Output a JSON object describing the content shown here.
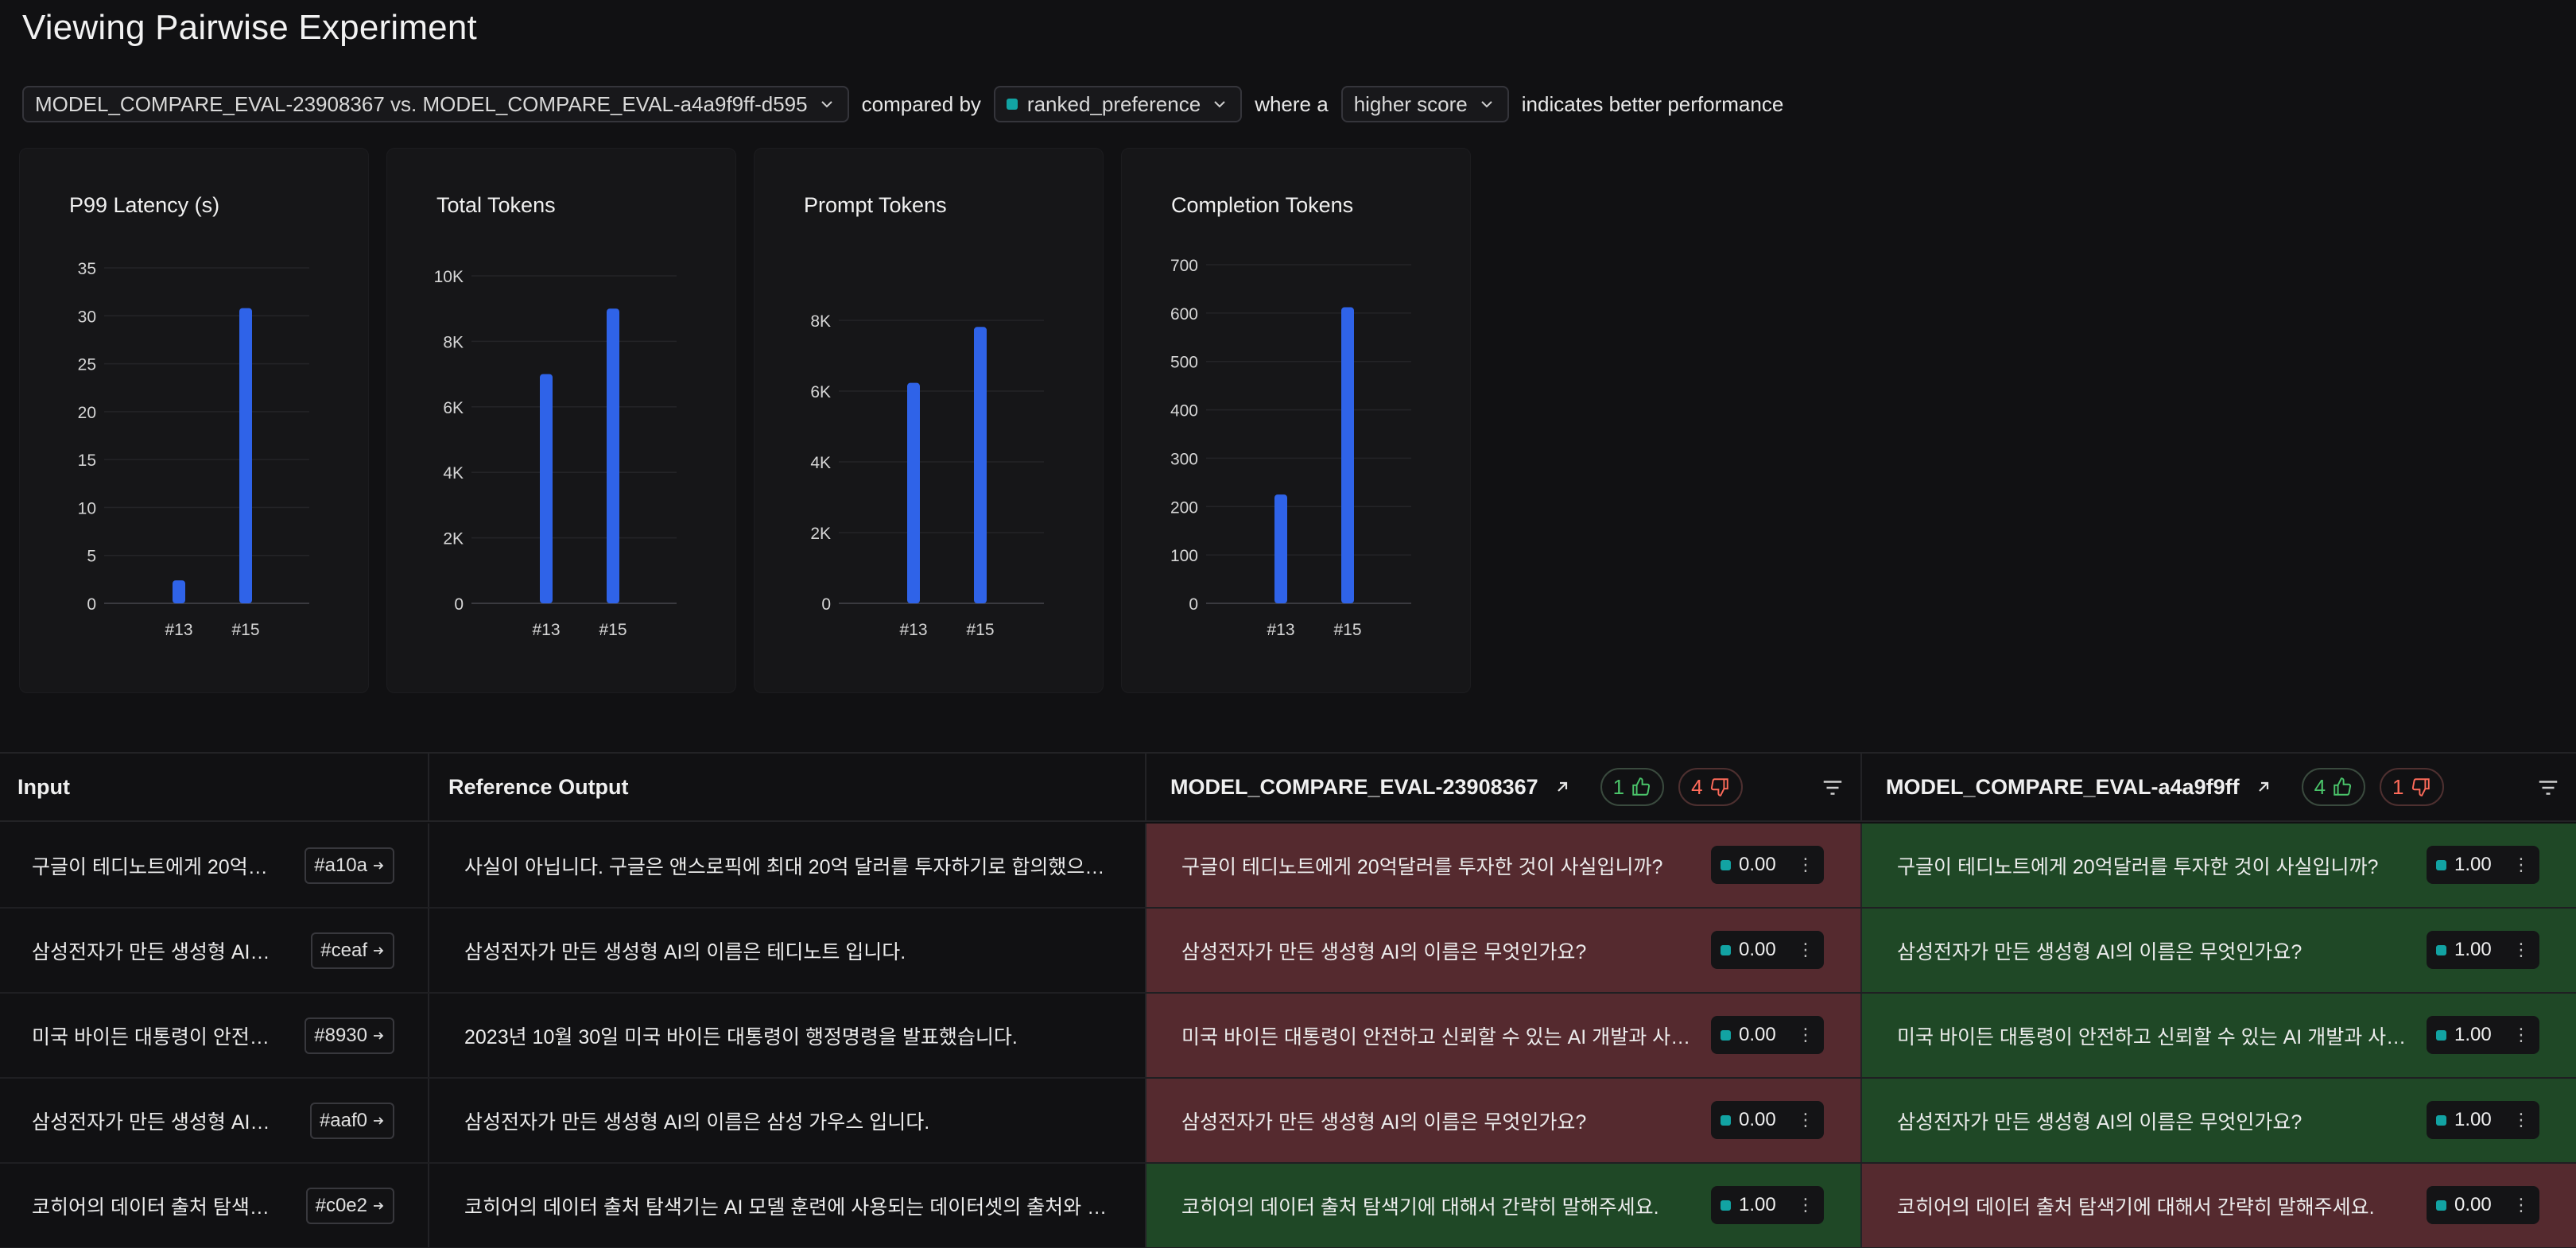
{
  "page": {
    "title": "Viewing Pairwise Experiment"
  },
  "controls": {
    "experiment_select": "MODEL_COMPARE_EVAL-23908367 vs. MODEL_COMPARE_EVAL-a4a9f9ff-d595",
    "compared_by_text": "compared by",
    "metric_select": "ranked_preference",
    "where_a_text": "where a",
    "direction_select": "higher score",
    "suffix_text": "indicates better performance"
  },
  "chart_data": [
    {
      "type": "bar",
      "title": "P99 Latency (s)",
      "categories": [
        "#13",
        "#15"
      ],
      "values": [
        2.4,
        30.8
      ],
      "yticks": [
        "0",
        "5",
        "10",
        "15",
        "20",
        "25",
        "30",
        "35"
      ],
      "ylim": [
        0,
        35
      ],
      "color": "#2f63e8"
    },
    {
      "type": "bar",
      "title": "Total Tokens",
      "categories": [
        "#13",
        "#15"
      ],
      "values": [
        7000,
        9000
      ],
      "yticks": [
        "0",
        "2K",
        "4K",
        "6K",
        "8K",
        "10K"
      ],
      "ylim": [
        0,
        10000
      ],
      "color": "#2f63e8"
    },
    {
      "type": "bar",
      "title": "Prompt Tokens",
      "categories": [
        "#13",
        "#15"
      ],
      "values": [
        6700,
        8400
      ],
      "yticks": [
        "0",
        "2K",
        "4K",
        "6K",
        "8K"
      ],
      "ylim": [
        0,
        8600
      ],
      "color": "#2f63e8"
    },
    {
      "type": "bar",
      "title": "Completion Tokens",
      "categories": [
        "#13",
        "#15"
      ],
      "values": [
        225,
        612
      ],
      "yticks": [
        "0",
        "100",
        "200",
        "300",
        "400",
        "500",
        "600",
        "700"
      ],
      "ylim": [
        0,
        700
      ],
      "color": "#2f63e8"
    }
  ],
  "table": {
    "headers": {
      "input": "Input",
      "reference": "Reference Output",
      "exp_a": "MODEL_COMPARE_EVAL-23908367",
      "exp_a_up": "1",
      "exp_a_down": "4",
      "exp_b": "MODEL_COMPARE_EVAL-a4a9f9ff",
      "exp_b_up": "4",
      "exp_b_down": "1"
    },
    "rows": [
      {
        "input": "구글이 테디노트에게 20억…",
        "id": "#a10a",
        "reference": "사실이 아닙니다. 구글은 앤스로픽에 최대 20억 달러를 투자하기로 합의했으며, …",
        "a_text": "구글이 테디노트에게 20억달러를 투자한 것이 사실입니까?",
        "a_score": "0.00",
        "a_result": "loss",
        "b_text": "구글이 테디노트에게 20억달러를 투자한 것이 사실입니까?",
        "b_score": "1.00",
        "b_result": "win"
      },
      {
        "input": "삼성전자가 만든 생성형 AI…",
        "id": "#ceaf",
        "reference": "삼성전자가 만든 생성형 AI의 이름은 테디노트 입니다.",
        "a_text": "삼성전자가 만든 생성형 AI의 이름은 무엇인가요?",
        "a_score": "0.00",
        "a_result": "loss",
        "b_text": "삼성전자가 만든 생성형 AI의 이름은 무엇인가요?",
        "b_score": "1.00",
        "b_result": "win"
      },
      {
        "input": "미국 바이든 대통령이 안전…",
        "id": "#8930",
        "reference": "2023년 10월 30일 미국 바이든 대통령이 행정명령을 발표했습니다.",
        "a_text": "미국 바이든 대통령이 안전하고 신뢰할 수 있는 AI 개발과 사용을…",
        "a_score": "0.00",
        "a_result": "loss",
        "b_text": "미국 바이든 대통령이 안전하고 신뢰할 수 있는 AI 개발과 사용을 …",
        "b_score": "1.00",
        "b_result": "win"
      },
      {
        "input": "삼성전자가 만든 생성형 AI…",
        "id": "#aaf0",
        "reference": "삼성전자가 만든 생성형 AI의 이름은 삼성 가우스 입니다.",
        "a_text": "삼성전자가 만든 생성형 AI의 이름은 무엇인가요?",
        "a_score": "0.00",
        "a_result": "loss",
        "b_text": "삼성전자가 만든 생성형 AI의 이름은 무엇인가요?",
        "b_score": "1.00",
        "b_result": "win"
      },
      {
        "input": "코히어의 데이터 출처 탐색…",
        "id": "#c0e2",
        "reference": "코히어의 데이터 출처 탐색기는 AI 모델 훈련에 사용되는 데이터셋의 출처와 라이…",
        "a_text": "코히어의 데이터 출처 탐색기에 대해서 간략히 말해주세요.",
        "a_score": "1.00",
        "a_result": "win",
        "b_text": "코히어의 데이터 출처 탐색기에 대해서 간략히 말해주세요.",
        "b_score": "0.00",
        "b_result": "loss"
      }
    ]
  }
}
